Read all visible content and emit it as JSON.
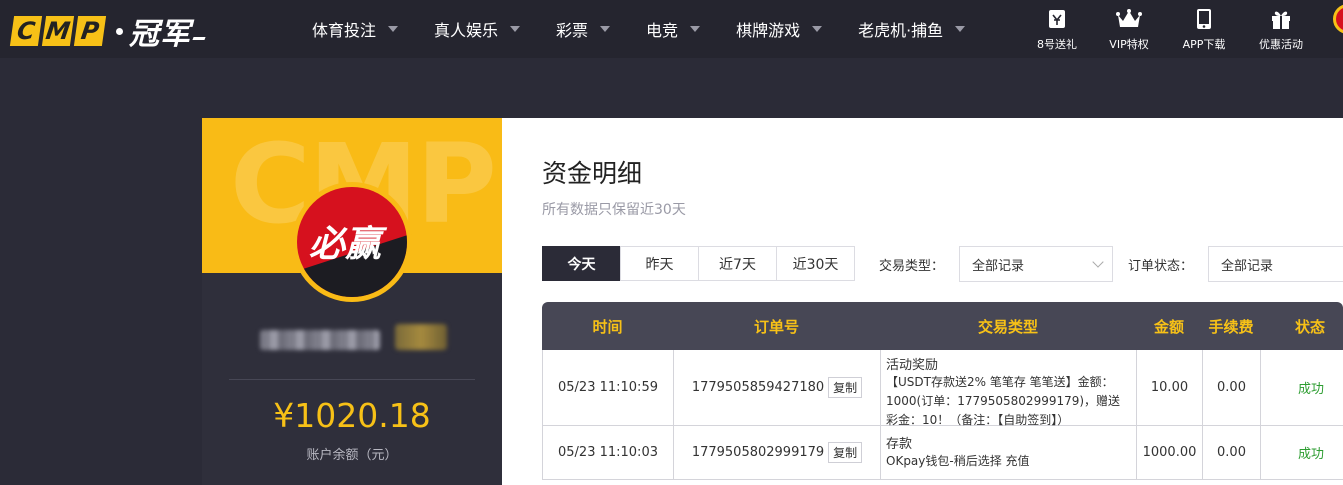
{
  "header": {
    "logo_letters": [
      "C",
      "M",
      "P"
    ],
    "logo_text": "冠军",
    "nav": [
      {
        "label": "体育投注"
      },
      {
        "label": "真人娱乐"
      },
      {
        "label": "彩票"
      },
      {
        "label": "电竞"
      },
      {
        "label": "棋牌游戏"
      },
      {
        "label": "老虎机·捕鱼"
      }
    ],
    "quick_links": [
      {
        "label": "8号送礼",
        "icon": "ticket-icon"
      },
      {
        "label": "VIP特权",
        "icon": "crown-icon"
      },
      {
        "label": "APP下载",
        "icon": "phone-icon"
      },
      {
        "label": "优惠活动",
        "icon": "gift-icon"
      }
    ]
  },
  "profile": {
    "watermark": "CMP",
    "avatar_text": "必赢",
    "balance": "¥1020.18",
    "balance_label": "账户余额（元）"
  },
  "main": {
    "title": "资金明细",
    "subtitle": "所有数据只保留近30天",
    "tabs": [
      {
        "label": "今天",
        "active": true
      },
      {
        "label": "昨天",
        "active": false
      },
      {
        "label": "近7天",
        "active": false
      },
      {
        "label": "近30天",
        "active": false
      }
    ],
    "filters": {
      "type_label": "交易类型：",
      "type_value": "全部记录",
      "status_label": "订单状态：",
      "status_value": "全部记录"
    },
    "table": {
      "columns": [
        "时间",
        "订单号",
        "交易类型",
        "金额",
        "手续费",
        "状态"
      ],
      "copy_label": "复制",
      "rows": [
        {
          "time": "05/23 11:10:59",
          "order_no": "1779505859427180",
          "type_title": "活动奖励",
          "type_desc": "【USDT存款送2% 笔笔存 笔笔送】金额：1000(订单：1779505802999179)，赠送彩金：10！（备注：【自助签到】）",
          "amount": "10.00",
          "fee": "0.00",
          "status": "成功"
        },
        {
          "time": "05/23 11:10:03",
          "order_no": "1779505802999179",
          "type_title": "存款",
          "type_desc": "OKpay钱包-稍后选择 充值",
          "amount": "1000.00",
          "fee": "0.00",
          "status": "成功"
        }
      ]
    }
  },
  "colors": {
    "accent": "#f7c117",
    "header_bg": "#25252f",
    "page_bg": "#2b2b37",
    "success": "#2d9d31"
  }
}
